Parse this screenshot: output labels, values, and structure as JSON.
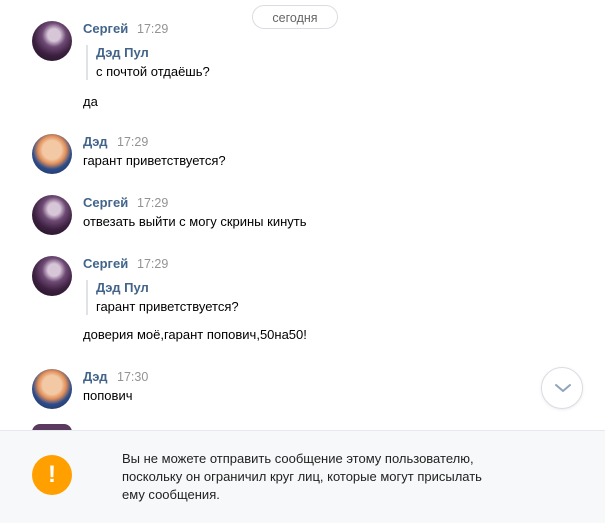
{
  "date_label": "сегодня",
  "messages": [
    {
      "author": "Сергей",
      "time": "17:29",
      "avatar": "sergey",
      "quote": {
        "author": "Дэд Пул",
        "text": "с почтой отдаёшь?"
      },
      "text": "да"
    },
    {
      "author": "Дэд",
      "time": "17:29",
      "avatar": "ded",
      "text": "гарант приветствуется?"
    },
    {
      "author": "Сергей",
      "time": "17:29",
      "avatar": "sergey",
      "text": "отвезать выйти с могу скрины кинуть"
    },
    {
      "author": "Сергей",
      "time": "17:29",
      "avatar": "sergey",
      "quote": {
        "author": "Дэд Пул",
        "text": "гарант приветствуется?"
      },
      "text": "доверия моё,гарант попович,50на50!"
    },
    {
      "author": "Дэд",
      "time": "17:30",
      "avatar": "ded",
      "text": "попович"
    }
  ],
  "notice": {
    "lines": [
      "Вы не можете отправить сообщение этому пользователю,",
      "поскольку он ограничил круг лиц, которые могут присылать",
      "ему сообщения."
    ],
    "icon": "exclamation-icon",
    "icon_glyph": "!",
    "icon_color": "#ffa000"
  },
  "colors": {
    "author": "#42648b",
    "time": "#939393"
  }
}
